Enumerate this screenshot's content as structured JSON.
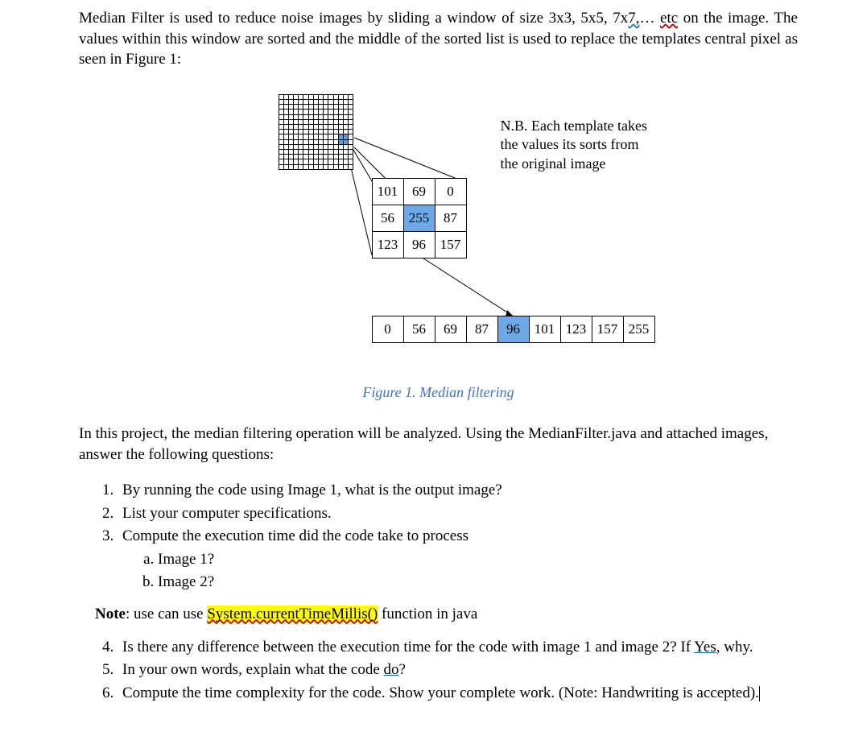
{
  "intro": "Median Filter is used to reduce noise images by sliding a window of size 3x3, 5x5, 7x7,… etc on the image. The values within this window are sorted and the middle of the sorted list is used to replace the templates central pixel as seen in Figure 1:",
  "intro_squiggle_1": "7,",
  "intro_squiggle_2": "etc",
  "nb_note_l1": "N.B. Each template takes",
  "nb_note_l2": "the values its sorts from",
  "nb_note_l3": "the original image",
  "kernel3x3": [
    [
      "101",
      "69",
      "0"
    ],
    [
      "56",
      "255",
      "87"
    ],
    [
      "123",
      "96",
      "157"
    ]
  ],
  "sorted": [
    "0",
    "56",
    "69",
    "87",
    "96",
    "101",
    "123",
    "157",
    "255"
  ],
  "caption": "Figure 1. Median filtering",
  "para2": "In this project, the median filtering operation will be analyzed. Using the MedianFilter.java and attached images, answer the following questions:",
  "q1": "By running the code using Image 1, what is the output image?",
  "q2": "List your computer specifications.",
  "q3": "Compute the execution time did the code take to process",
  "q3a": "Image 1?",
  "q3b": "Image 2?",
  "note_prefix": "Note",
  "note_mid": ": use can use ",
  "note_code": "System.currentTimeMillis()",
  "note_suffix": " function in java",
  "q4_a": "Is there any difference between the execution time for the code with image 1 and image 2? If ",
  "q4_yes": "Yes",
  "q4_b": ", why.",
  "q5_a": "In your own words, explain what the code ",
  "q5_do": "do",
  "q5_b": "?",
  "q6": "Compute the time complexity for the code. Show your complete work. (Note: Handwriting is accepted).",
  "highlighted_cells": {
    "kernel_center": [
      1,
      1
    ],
    "sorted_median": 4
  }
}
